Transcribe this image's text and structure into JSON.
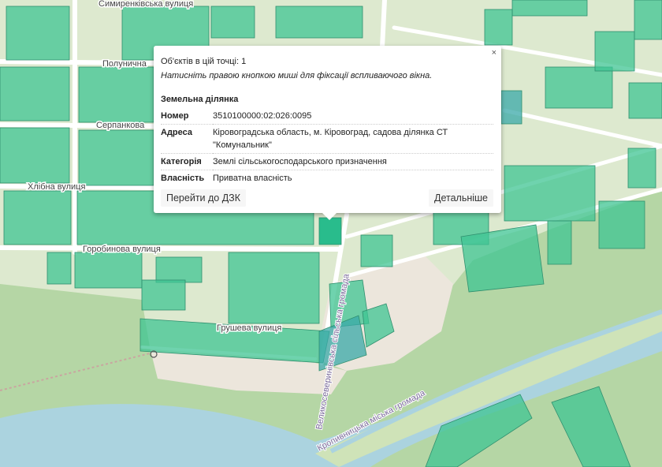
{
  "map": {
    "streets": [
      "Симиренківська вулиця",
      "Полунична",
      "Серпанкова",
      "Хлібна вулиця",
      "Горобинова вулиця",
      "Грушева вулиця"
    ],
    "boundaries": [
      "Великосеверинівська сільська громада",
      "Кропивницька міська громада"
    ]
  },
  "popup": {
    "close": "×",
    "objects_count": "Об'єктів в цій точці: 1",
    "hint": "Натисніть правою кнопкою миші для фіксації вспливаючого вікна.",
    "section": "Земельна ділянка",
    "rows": [
      {
        "key": "Номер",
        "value": "3510100000:02:026:0095"
      },
      {
        "key": "Адреса",
        "value": "Кіровоградська область, м. Кіровоград, садова ділянка СТ \"Комунальник\""
      },
      {
        "key": "Категорія",
        "value": "Землі сільськогосподарського призначення"
      },
      {
        "key": "Власність",
        "value": "Приватна власність"
      }
    ],
    "btn_dzk": "Перейти до ДЗК",
    "btn_more": "Детальніше"
  },
  "colors": {
    "parcel": "#3fc493",
    "selected": "#1fb988",
    "water": "#abd3df",
    "forest": "#add19e"
  }
}
